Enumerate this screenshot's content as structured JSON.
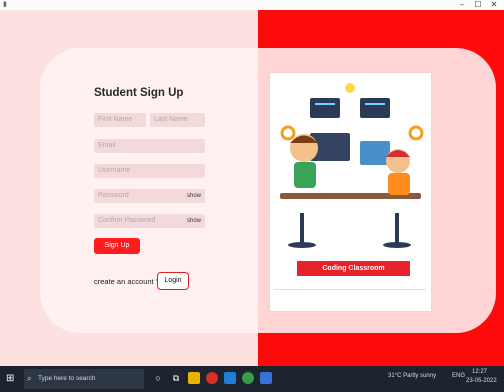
{
  "window": {
    "minimize": "–",
    "maximize": "☐",
    "close": "✕"
  },
  "form": {
    "title": "Student Sign Up",
    "first_name_placeholder": "First Name",
    "last_name_placeholder": "Last Name",
    "email_placeholder": "Email",
    "username_placeholder": "Username",
    "password_placeholder": "Password",
    "confirm_password_placeholder": "Confirm Password",
    "show_label": "show",
    "signup_button": "Sign Up",
    "account_text": "create an account ?",
    "login_button": "Login"
  },
  "poster": {
    "banner": "Coding Classroom"
  },
  "taskbar": {
    "search_placeholder": "Type here to search",
    "weather": "31°C Partly sunny",
    "lang": "ENG",
    "time": "12:27",
    "date": "23-05-2022"
  },
  "colors": {
    "accent": "#ff0a0a",
    "panel": "#fde0e0"
  }
}
